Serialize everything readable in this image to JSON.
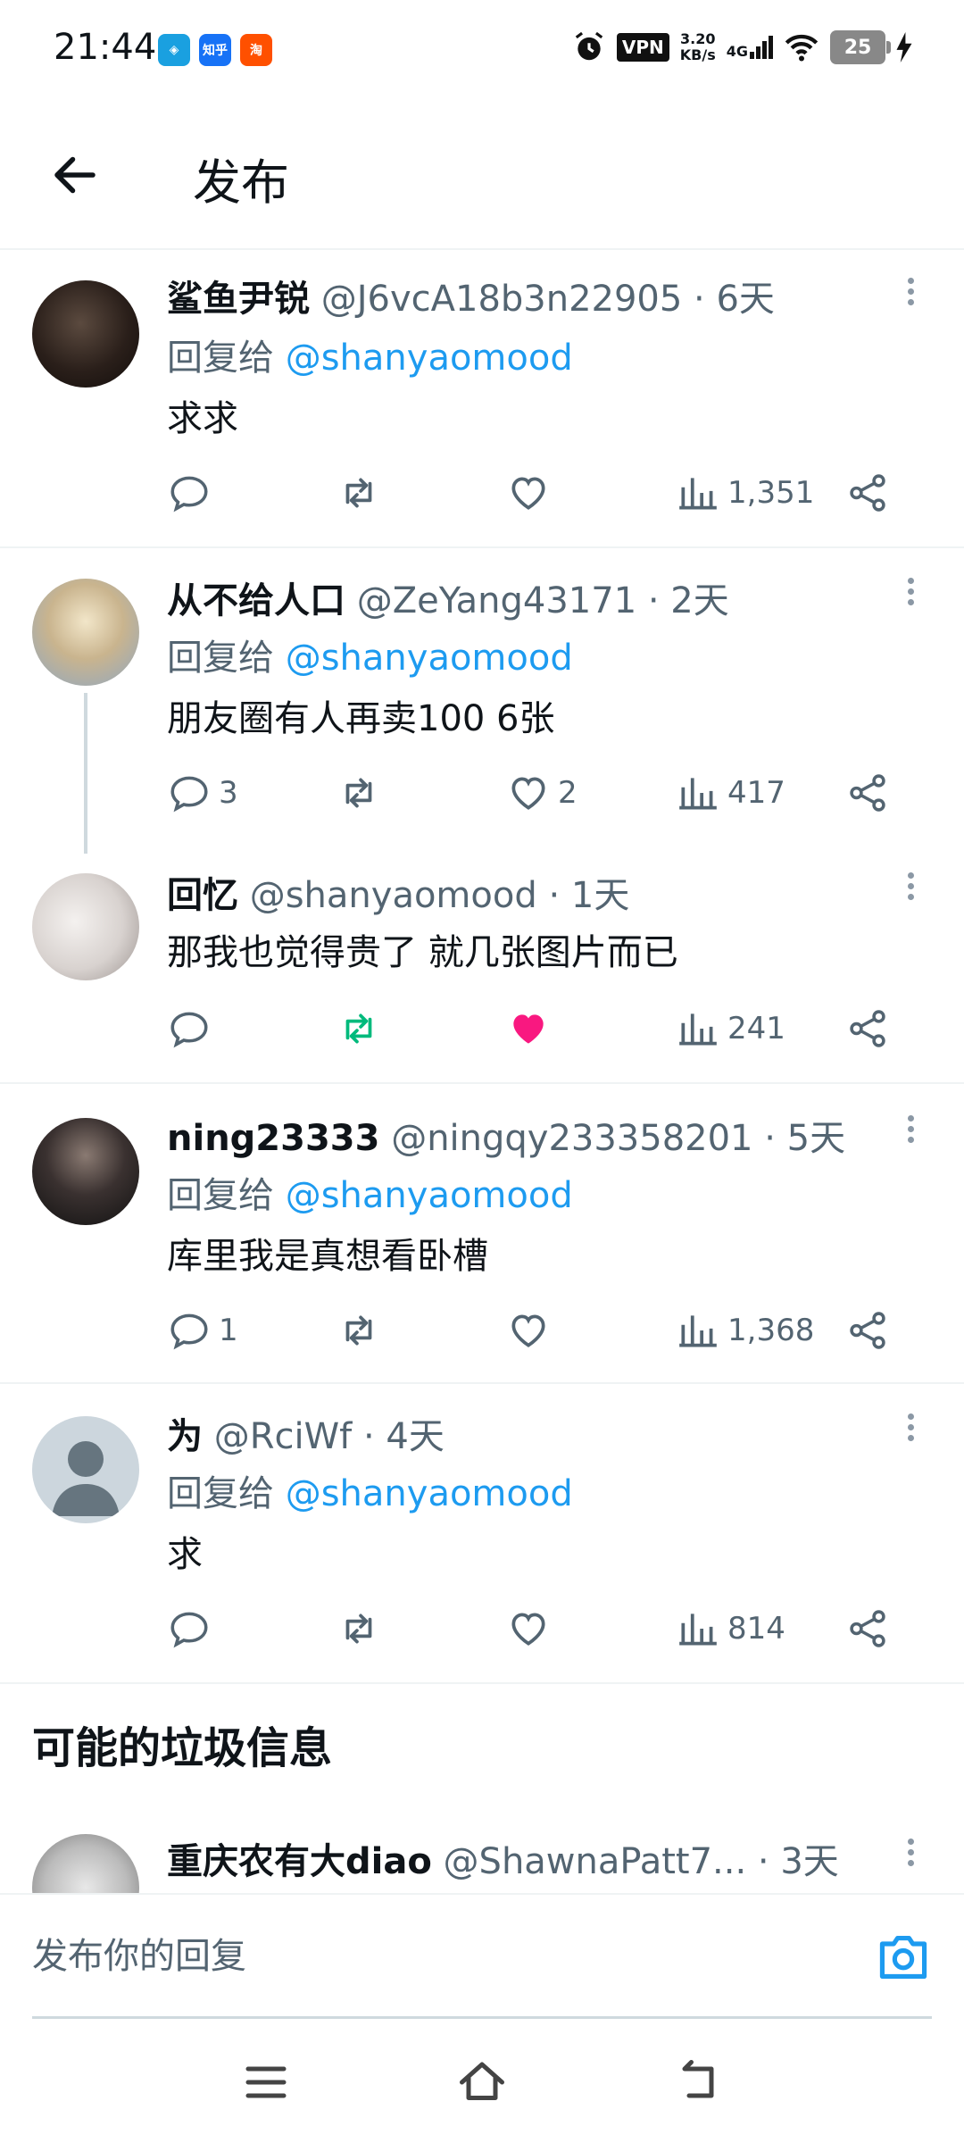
{
  "status_bar": {
    "time": "21:44",
    "apps": [
      {
        "name": "app-icon-1",
        "glyph": "◈",
        "color": "#1aa0e0"
      },
      {
        "name": "zhihu-app-icon",
        "glyph": "知乎",
        "color": "#1772f6"
      },
      {
        "name": "taobao-app-icon",
        "glyph": "淘",
        "color": "#ff5000"
      }
    ],
    "vpn": "VPN",
    "speed_value": "3.20",
    "speed_unit": "KB/s",
    "network": "4G",
    "battery": "25"
  },
  "header": {
    "title": "发布"
  },
  "tweets": [
    {
      "name": "鲨鱼尹锐",
      "handle": "@J6vcA18b3n22905 · 6天",
      "reply_prefix": "回复给",
      "mention": "@shanyaomood",
      "text": "求求",
      "replies": "",
      "retweets": "",
      "likes": "",
      "views": "1,351",
      "liked": false,
      "retweeted": false
    },
    {
      "name": "从不给人口",
      "handle": "@ZeYang43171 · 2天",
      "reply_prefix": "回复给",
      "mention": "@shanyaomood",
      "text": "朋友圈有人再卖100 6张",
      "replies": "3",
      "retweets": "",
      "likes": "2",
      "views": "417",
      "liked": false,
      "retweeted": false
    },
    {
      "name": "回忆",
      "handle": "@shanyaomood · 1天",
      "reply_prefix": "",
      "mention": "",
      "text": "那我也觉得贵了 就几张图片而已",
      "replies": "",
      "retweets": "",
      "likes": "",
      "views": "241",
      "liked": true,
      "retweeted": true
    },
    {
      "name": "ning23333",
      "handle": "@ningqy233358201 · 5天",
      "reply_prefix": "回复给",
      "mention": "@shanyaomood",
      "text": "库里我是真想看卧槽",
      "replies": "1",
      "retweets": "",
      "likes": "",
      "views": "1,368",
      "liked": false,
      "retweeted": false
    },
    {
      "name": "为",
      "handle": "@RciWf · 4天",
      "reply_prefix": "回复给",
      "mention": "@shanyaomood",
      "text": "求",
      "replies": "",
      "retweets": "",
      "likes": "",
      "views": "814",
      "liked": false,
      "retweeted": false
    }
  ],
  "spam_section": {
    "title": "可能的垃圾信息",
    "tweet": {
      "name": "重庆农有大diao",
      "handle": "@ShawnaPatt7... · 3天"
    }
  },
  "compose": {
    "placeholder": "发布你的回复"
  },
  "colors": {
    "accent": "#1d9bf0",
    "like": "#f91880",
    "retweet": "#00ba7c",
    "muted": "#536471"
  }
}
